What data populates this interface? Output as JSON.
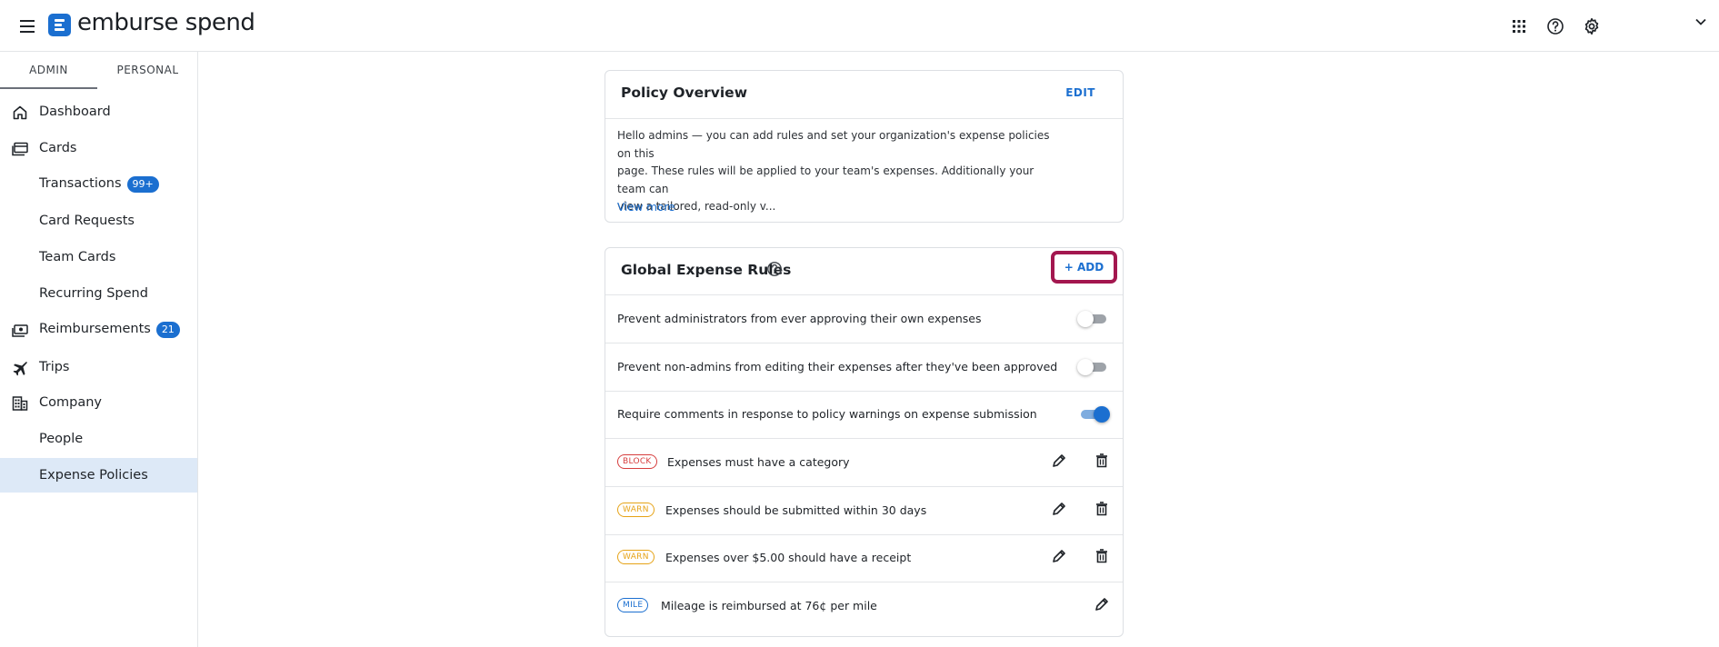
{
  "app": {
    "brand_name": "emburse spend"
  },
  "header": {
    "icons": [
      "apps-grid-icon",
      "help-circle-icon",
      "settings-gear-icon",
      "chevron-down-icon"
    ]
  },
  "sidebar": {
    "tabs": [
      {
        "label": "ADMIN",
        "selected": true
      },
      {
        "label": "PERSONAL",
        "selected": false
      }
    ],
    "items": [
      {
        "label": "Dashboard",
        "icon": "home-icon"
      },
      {
        "label": "Cards",
        "icon": "cards-icon"
      },
      {
        "label": "Transactions",
        "badge": "99+"
      },
      {
        "label": "Card Requests"
      },
      {
        "label": "Team Cards"
      },
      {
        "label": "Recurring Spend"
      },
      {
        "label": "Reimbursements",
        "icon": "money-icon",
        "badge": "21"
      },
      {
        "label": "Trips",
        "icon": "airplane-icon"
      },
      {
        "label": "Company",
        "icon": "building-icon"
      },
      {
        "label": "People"
      },
      {
        "label": "Expense Policies",
        "active": true
      }
    ]
  },
  "overview": {
    "title": "Policy Overview",
    "edit_label": "EDIT",
    "text_lines": [
      "Hello admins — you can add rules and set your organization's expense policies on this",
      "page. These rules will be applied to your team's expenses. Additionally your team can",
      "view a tailored, read-only v..."
    ],
    "view_more": "View more"
  },
  "rules": {
    "title": "Global Expense Rules",
    "add_label": "+ ADD",
    "toggles": [
      {
        "text": "Prevent administrators from ever approving their own expenses",
        "on": false
      },
      {
        "text": "Prevent non-admins from editing their expenses after they've been approved",
        "on": false
      },
      {
        "text": "Require comments in response to policy warnings on expense submission",
        "on": true
      }
    ],
    "tagged": [
      {
        "tag": "BLOCK",
        "text": "Expenses must have a category"
      },
      {
        "tag": "WARN",
        "text": "Expenses should be submitted within 30 days"
      },
      {
        "tag": "WARN",
        "text": "Expenses over $5.00 should have a receipt"
      },
      {
        "tag": "MILE",
        "text": "Mileage is reimbursed at 76¢ per mile"
      }
    ]
  },
  "colors": {
    "accent": "#1b6fd0",
    "highlight_border": "#a3174f",
    "block": "#d63d3d",
    "warn": "#e6a317",
    "active_nav_bg": "#dde9f7"
  }
}
